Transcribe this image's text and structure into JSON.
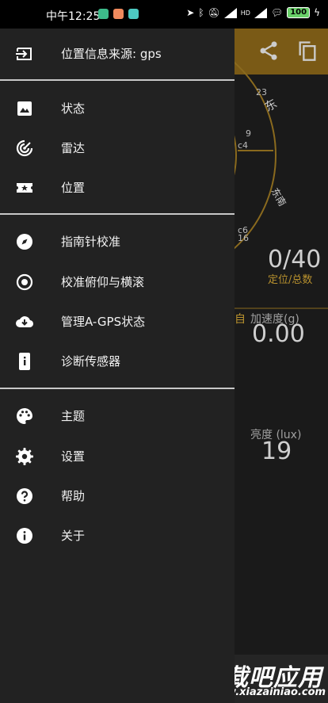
{
  "status_bar": {
    "time": "中午12:25",
    "network_badge": "HD",
    "battery": "100"
  },
  "background_app": {
    "compass_labels": [
      "东",
      "东南"
    ],
    "satellite_labels": [
      "23",
      "9",
      "c4",
      "c6",
      "16"
    ],
    "satellites_value": "0/40",
    "satellites_caption": "定位/总数",
    "accel_caption_prefix": "自",
    "accel_caption": "加速度(g)",
    "accel_value": "0.00",
    "brightness_caption": "亮度 (lux)",
    "brightness_value": "19"
  },
  "drawer": {
    "header": {
      "label": "位置信息来源: gps",
      "icon": "exit-to-app-icon"
    },
    "group1": [
      {
        "label": "状态",
        "icon": "image-icon"
      },
      {
        "label": "雷达",
        "icon": "radar-icon"
      },
      {
        "label": "位置",
        "icon": "ticket-star-icon"
      }
    ],
    "group2": [
      {
        "label": "指南针校准",
        "icon": "compass-icon"
      },
      {
        "label": "校准俯仰与横滚",
        "icon": "target-icon"
      },
      {
        "label": "管理A-GPS状态",
        "icon": "cloud-download-icon"
      },
      {
        "label": "诊断传感器",
        "icon": "device-info-icon"
      }
    ],
    "group3": [
      {
        "label": "主题",
        "icon": "palette-icon"
      },
      {
        "label": "设置",
        "icon": "gear-icon"
      },
      {
        "label": "帮助",
        "icon": "help-icon"
      },
      {
        "label": "关于",
        "icon": "info-icon"
      }
    ]
  },
  "watermark": {
    "title": "下载吧应用",
    "url": "www.xiazainiao.com"
  },
  "colors": {
    "drawer_bg": "#222222",
    "toolbar": "#7a5a16",
    "accent": "#b8912e",
    "divider": "#c8c8c8"
  }
}
